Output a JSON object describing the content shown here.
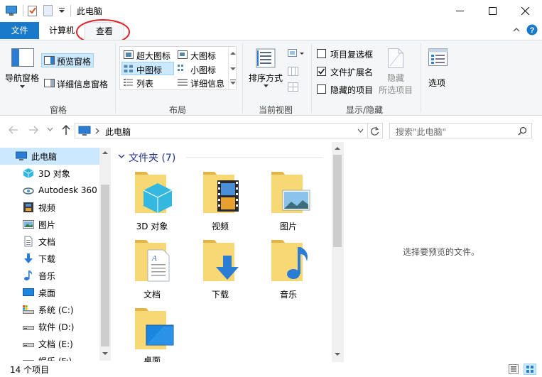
{
  "window": {
    "title": "此电脑",
    "minimize_glyph": "—",
    "close_glyph": "✕"
  },
  "ribbon_tabs": [
    {
      "label": "文件"
    },
    {
      "label": "计算机"
    },
    {
      "label": "查看"
    }
  ],
  "ribbon": {
    "pane_group": {
      "label": "窗格",
      "nav_pane": "导航窗格",
      "preview_pane": "预览窗格",
      "details_pane": "详细信息窗格"
    },
    "layout_group": {
      "label": "布局",
      "options": [
        "超大图标",
        "大图标",
        "中图标",
        "小图标",
        "列表",
        "详细信息"
      ],
      "selected": "中图标"
    },
    "current_view_group": {
      "label": "当前视图",
      "sort": "排序方式"
    },
    "show_hide_group": {
      "label": "显示/隐藏",
      "checkboxes": [
        {
          "label": "项目复选框",
          "checked": false
        },
        {
          "label": "文件扩展名",
          "checked": true
        },
        {
          "label": "隐藏的项目",
          "checked": false
        }
      ],
      "hide_selected": "隐藏\n所选项目",
      "hide_line1": "隐藏",
      "hide_line2": "所选项目"
    },
    "options": "选项"
  },
  "address": {
    "path": "此电脑",
    "search_placeholder": "搜索\"此电脑\""
  },
  "nav": {
    "items": [
      {
        "label": "此电脑",
        "icon": "computer-icon"
      },
      {
        "label": "3D 对象",
        "icon": "3d-objects-icon"
      },
      {
        "label": "Autodesk 360",
        "icon": "autodesk-icon"
      },
      {
        "label": "视频",
        "icon": "video-icon"
      },
      {
        "label": "图片",
        "icon": "pictures-icon"
      },
      {
        "label": "文档",
        "icon": "documents-icon"
      },
      {
        "label": "下载",
        "icon": "download-icon"
      },
      {
        "label": "音乐",
        "icon": "music-icon"
      },
      {
        "label": "桌面",
        "icon": "desktop-icon"
      },
      {
        "label": "系统 (C:)",
        "icon": "drive-icon"
      },
      {
        "label": "软件 (D:)",
        "icon": "drive-icon"
      },
      {
        "label": "文档 (E:)",
        "icon": "drive-icon"
      },
      {
        "label": "娱乐 (F:)",
        "icon": "drive-icon"
      }
    ]
  },
  "content": {
    "section_title": "文件夹 (7)",
    "folders": [
      {
        "label": "3D 对象",
        "icon": "3d-objects-folder-icon"
      },
      {
        "label": "视频",
        "icon": "video-folder-icon"
      },
      {
        "label": "图片",
        "icon": "pictures-folder-icon"
      },
      {
        "label": "文档",
        "icon": "documents-folder-icon"
      },
      {
        "label": "下载",
        "icon": "download-folder-icon"
      },
      {
        "label": "音乐",
        "icon": "music-folder-icon"
      },
      {
        "label": "桌面",
        "icon": "desktop-folder-icon"
      }
    ]
  },
  "preview": {
    "empty_text": "选择要预览的文件。"
  },
  "status": {
    "item_count": "14 个项目"
  },
  "colors": {
    "accent": "#1979ca",
    "folder": "#f8d775",
    "selected_bg": "#cce8ff",
    "annotation": "#e0202a"
  }
}
